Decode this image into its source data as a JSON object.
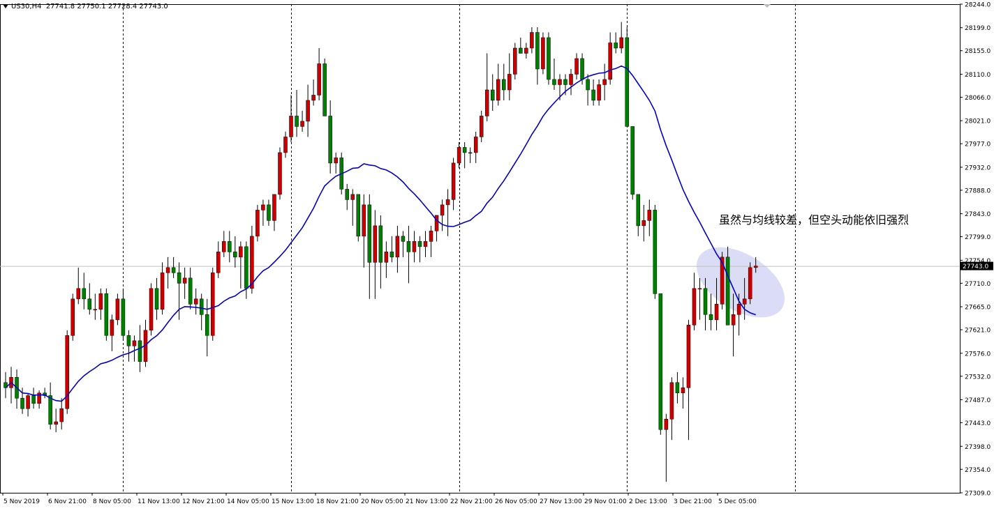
{
  "header": {
    "symbol": "US30,H4",
    "ohlc": "27741.8 27750.1 27728.4 27743.0"
  },
  "annotation": "虽然与均线较差，但空头动能依旧强烈",
  "colors": {
    "up": "#cc0000",
    "down": "#008000",
    "ma": "#0000cc",
    "ellipse": "#c8caf0",
    "grid": "#000000",
    "price_line": "#c0c0c0"
  },
  "chart_data": {
    "type": "candlestick",
    "ylim": [
      27309.0,
      28244.0
    ],
    "y_ticks": [
      "28244.0",
      "28199.0",
      "28155.0",
      "28110.0",
      "28066.0",
      "28021.0",
      "27977.0",
      "27932.0",
      "27888.0",
      "27843.0",
      "27799.0",
      "27754.0",
      "27710.0",
      "27665.0",
      "27621.0",
      "27576.0",
      "27532.0",
      "27487.0",
      "27443.0",
      "27398.0",
      "27354.0",
      "27309.0"
    ],
    "x_labels": [
      "5 Nov 2019",
      "6 Nov 21:00",
      "8 Nov 05:00",
      "11 Nov 13:00",
      "12 Nov 21:00",
      "14 Nov 05:00",
      "15 Nov 13:00",
      "18 Nov 21:00",
      "20 Nov 05:00",
      "21 Nov 13:00",
      "22 Nov 21:00",
      "26 Nov 05:00",
      "27 Nov 13:00",
      "29 Nov 01:00",
      "2 Dec 13:00",
      "3 Dec 21:00",
      "5 Dec 05:00"
    ],
    "current_price": "27743.0",
    "candles": [
      [
        27520,
        27540,
        27490,
        27510
      ],
      [
        27510,
        27550,
        27480,
        27530
      ],
      [
        27530,
        27545,
        27470,
        27490
      ],
      [
        27490,
        27510,
        27460,
        27470
      ],
      [
        27470,
        27500,
        27455,
        27495
      ],
      [
        27495,
        27510,
        27470,
        27480
      ],
      [
        27480,
        27505,
        27470,
        27500
      ],
      [
        27500,
        27510,
        27490,
        27495
      ],
      [
        27495,
        27520,
        27430,
        27440
      ],
      [
        27440,
        27470,
        27425,
        27445
      ],
      [
        27445,
        27490,
        27430,
        27470
      ],
      [
        27470,
        27620,
        27460,
        27610
      ],
      [
        27610,
        27690,
        27600,
        27680
      ],
      [
        27680,
        27740,
        27670,
        27700
      ],
      [
        27700,
        27730,
        27660,
        27680
      ],
      [
        27680,
        27710,
        27650,
        27660
      ],
      [
        27660,
        27690,
        27640,
        27660
      ],
      [
        27660,
        27700,
        27640,
        27690
      ],
      [
        27690,
        27700,
        27600,
        27610
      ],
      [
        27610,
        27650,
        27580,
        27640
      ],
      [
        27640,
        27690,
        27630,
        27680
      ],
      [
        27680,
        27700,
        27600,
        27610
      ],
      [
        27610,
        27620,
        27560,
        27590
      ],
      [
        27590,
        27610,
        27560,
        27600
      ],
      [
        27600,
        27630,
        27540,
        27560
      ],
      [
        27560,
        27640,
        27550,
        27620
      ],
      [
        27620,
        27710,
        27610,
        27700
      ],
      [
        27700,
        27720,
        27640,
        27660
      ],
      [
        27660,
        27750,
        27650,
        27730
      ],
      [
        27730,
        27760,
        27700,
        27740
      ],
      [
        27740,
        27760,
        27720,
        27730
      ],
      [
        27730,
        27750,
        27640,
        27710
      ],
      [
        27710,
        27740,
        27680,
        27720
      ],
      [
        27720,
        27740,
        27660,
        27670
      ],
      [
        27670,
        27700,
        27650,
        27680
      ],
      [
        27680,
        27690,
        27620,
        27650
      ],
      [
        27650,
        27680,
        27570,
        27610
      ],
      [
        27610,
        27740,
        27600,
        27730
      ],
      [
        27730,
        27790,
        27720,
        27770
      ],
      [
        27770,
        27810,
        27760,
        27790
      ],
      [
        27790,
        27810,
        27750,
        27770
      ],
      [
        27770,
        27800,
        27740,
        27760
      ],
      [
        27760,
        27790,
        27700,
        27780
      ],
      [
        27780,
        27790,
        27680,
        27700
      ],
      [
        27700,
        27820,
        27690,
        27800
      ],
      [
        27800,
        27860,
        27790,
        27850
      ],
      [
        27850,
        27870,
        27820,
        27860
      ],
      [
        27860,
        27870,
        27820,
        27830
      ],
      [
        27830,
        27880,
        27810,
        27880
      ],
      [
        27880,
        27970,
        27870,
        27960
      ],
      [
        27960,
        28000,
        27950,
        27990
      ],
      [
        27990,
        28070,
        27980,
        28030
      ],
      [
        28030,
        28080,
        27990,
        28010
      ],
      [
        28010,
        28040,
        28000,
        28020
      ],
      [
        28020,
        28090,
        27990,
        28060
      ],
      [
        28060,
        28100,
        28050,
        28070
      ],
      [
        28070,
        28160,
        28060,
        28130
      ],
      [
        28130,
        28140,
        28030,
        28030
      ],
      [
        28030,
        28060,
        27920,
        27940
      ],
      [
        27940,
        27960,
        27920,
        27950
      ],
      [
        27950,
        27960,
        27880,
        27890
      ],
      [
        27890,
        27900,
        27850,
        27870
      ],
      [
        27870,
        27890,
        27820,
        27880
      ],
      [
        27880,
        27880,
        27790,
        27800
      ],
      [
        27800,
        27880,
        27740,
        27860
      ],
      [
        27860,
        27880,
        27680,
        27750
      ],
      [
        27750,
        27850,
        27680,
        27820
      ],
      [
        27820,
        27840,
        27700,
        27750
      ],
      [
        27750,
        27790,
        27720,
        27770
      ],
      [
        27770,
        27800,
        27750,
        27760
      ],
      [
        27760,
        27820,
        27730,
        27800
      ],
      [
        27800,
        27810,
        27760,
        27790
      ],
      [
        27790,
        27820,
        27710,
        27770
      ],
      [
        27770,
        27810,
        27750,
        27790
      ],
      [
        27790,
        27800,
        27750,
        27780
      ],
      [
        27780,
        27810,
        27760,
        27790
      ],
      [
        27790,
        27820,
        27760,
        27810
      ],
      [
        27810,
        27840,
        27790,
        27840
      ],
      [
        27840,
        27870,
        27810,
        27860
      ],
      [
        27860,
        27890,
        27800,
        27870
      ],
      [
        27870,
        27950,
        27850,
        27940
      ],
      [
        27940,
        27980,
        27930,
        27970
      ],
      [
        27970,
        27980,
        27930,
        27960
      ],
      [
        27960,
        27970,
        27940,
        27960
      ],
      [
        27960,
        28000,
        27940,
        27990
      ],
      [
        27990,
        28040,
        27980,
        28030
      ],
      [
        28030,
        28150,
        28020,
        28080
      ],
      [
        28080,
        28110,
        28040,
        28060
      ],
      [
        28060,
        28130,
        28050,
        28100
      ],
      [
        28100,
        28130,
        28060,
        28080
      ],
      [
        28080,
        28150,
        28060,
        28110
      ],
      [
        28110,
        28170,
        28100,
        28160
      ],
      [
        28160,
        28180,
        28150,
        28150
      ],
      [
        28150,
        28170,
        28140,
        28160
      ],
      [
        28160,
        28200,
        28150,
        28190
      ],
      [
        28190,
        28200,
        28090,
        28120
      ],
      [
        28120,
        28190,
        28110,
        28180
      ],
      [
        28180,
        28190,
        28090,
        28100
      ],
      [
        28100,
        28140,
        28080,
        28090
      ],
      [
        28090,
        28110,
        28060,
        28100
      ],
      [
        28100,
        28110,
        28070,
        28090
      ],
      [
        28090,
        28120,
        28070,
        28110
      ],
      [
        28110,
        28150,
        28100,
        28140
      ],
      [
        28140,
        28150,
        28090,
        28100
      ],
      [
        28100,
        28110,
        28050,
        28080
      ],
      [
        28080,
        28100,
        28050,
        28060
      ],
      [
        28060,
        28100,
        28050,
        28090
      ],
      [
        28090,
        28130,
        28060,
        28100
      ],
      [
        28100,
        28190,
        28090,
        28170
      ],
      [
        28170,
        28190,
        28150,
        28160
      ],
      [
        28160,
        28210,
        28150,
        28180
      ],
      [
        28180,
        28200,
        28010,
        28010
      ],
      [
        28010,
        27990,
        27870,
        27880
      ],
      [
        27880,
        27880,
        27800,
        27820
      ],
      [
        27820,
        27860,
        27790,
        27830
      ],
      [
        27830,
        27870,
        27800,
        27850
      ],
      [
        27850,
        27860,
        27680,
        27690
      ],
      [
        27690,
        27690,
        27420,
        27430
      ],
      [
        27430,
        27460,
        27330,
        27450
      ],
      [
        27450,
        27530,
        27410,
        27520
      ],
      [
        27520,
        27540,
        27480,
        27500
      ],
      [
        27500,
        27530,
        27470,
        27510
      ],
      [
        27510,
        27640,
        27410,
        27630
      ],
      [
        27630,
        27730,
        27620,
        27700
      ],
      [
        27700,
        27720,
        27640,
        27700
      ],
      [
        27700,
        27720,
        27620,
        27650
      ],
      [
        27650,
        27690,
        27620,
        27640
      ],
      [
        27640,
        27720,
        27620,
        27670
      ],
      [
        27670,
        27770,
        27660,
        27760
      ],
      [
        27760,
        27780,
        27630,
        27630
      ],
      [
        27630,
        27690,
        27570,
        27650
      ],
      [
        27650,
        27690,
        27610,
        27670
      ],
      [
        27670,
        27720,
        27640,
        27680
      ],
      [
        27680,
        27750,
        27670,
        27740
      ],
      [
        27740,
        27760,
        27730,
        27743
      ]
    ],
    "ma_period": 21
  }
}
